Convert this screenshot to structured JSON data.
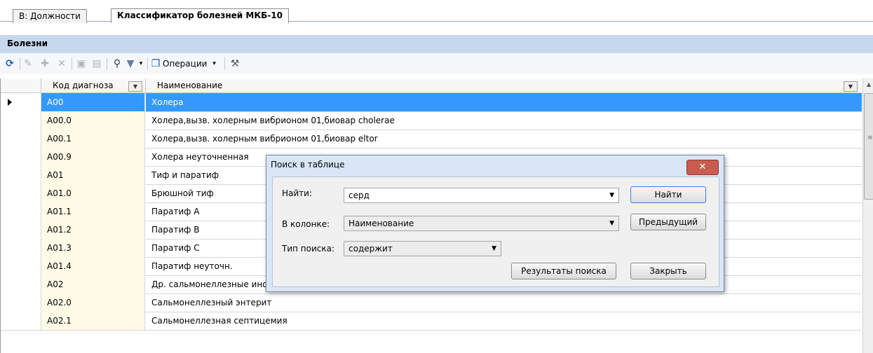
{
  "tabs": [
    {
      "label": "В: Должности",
      "active": false
    },
    {
      "label": "Классификатор болезней МКБ-10",
      "active": true
    }
  ],
  "section_title": "Болезни",
  "toolbar": {
    "operations_label": "Операции"
  },
  "grid": {
    "columns": [
      "Код диагноза",
      "Наименование"
    ],
    "rows": [
      {
        "code": "A00",
        "name": "Холера",
        "selected": true
      },
      {
        "code": "A00.0",
        "name": "Холера,вызв. холерным вибрионом 01,биовар cholerae"
      },
      {
        "code": "A00.1",
        "name": "Холера,вызв. холерным вибрионом 01,биовар eltor"
      },
      {
        "code": "A00.9",
        "name": "Холера неуточненная"
      },
      {
        "code": "A01",
        "name": "Тиф и паратиф"
      },
      {
        "code": "A01.0",
        "name": "Брюшной тиф"
      },
      {
        "code": "A01.1",
        "name": "Паратиф A"
      },
      {
        "code": "A01.2",
        "name": "Паратиф B"
      },
      {
        "code": "A01.3",
        "name": "Паратиф C"
      },
      {
        "code": "A01.4",
        "name": "Паратиф неуточн."
      },
      {
        "code": "A02",
        "name": "Др. сальмонеллезные инфекции"
      },
      {
        "code": "A02.0",
        "name": "Сальмонеллезный энтерит"
      },
      {
        "code": "A02.1",
        "name": "Сальмонеллезная септицемия"
      }
    ]
  },
  "dialog": {
    "title": "Поиск в таблице",
    "find_label": "Найти:",
    "find_value": "серд",
    "column_label": "В колонке:",
    "column_value": "Наименование",
    "search_type_label": "Тип поиска:",
    "search_type_value": "содержит",
    "find_button": "Найти",
    "previous_button": "Предыдущий",
    "results_button": "Результаты поиска",
    "close_button": "Закрыть"
  },
  "colors": {
    "selection": "#3399ff",
    "code_cell": "#fffbe7",
    "section_header": "#c7d8ee"
  }
}
